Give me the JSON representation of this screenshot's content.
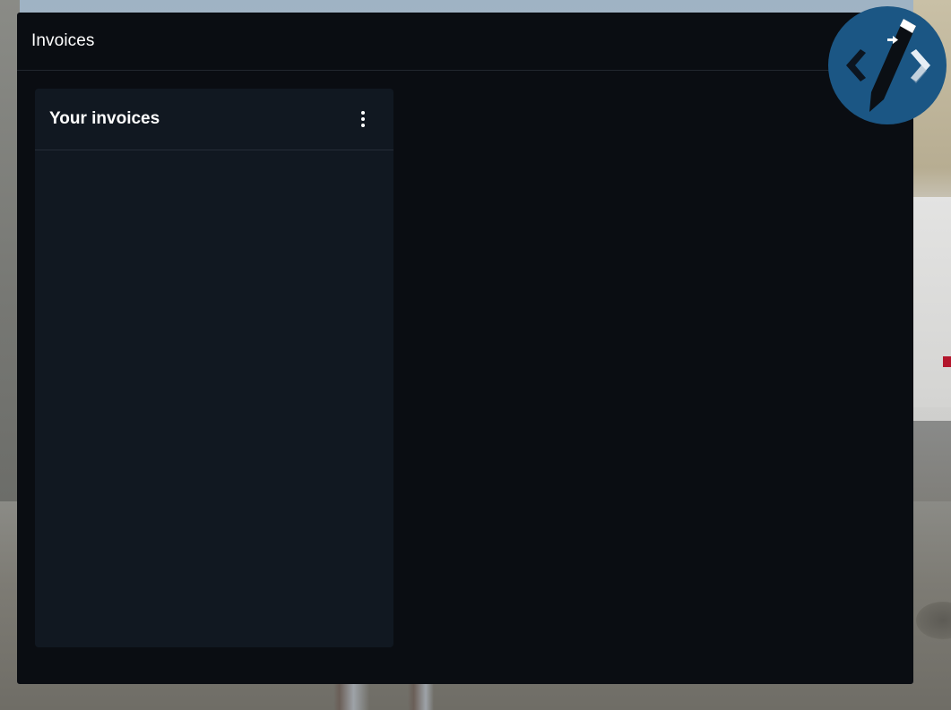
{
  "window": {
    "title": "Invoices"
  },
  "invoices_card": {
    "title": "Your invoices",
    "menu_icon": "more-vertical-icon"
  },
  "overlay": {
    "logo_icon": "code-pencil-logo"
  },
  "colors": {
    "window_background": "#0a0d12",
    "card_background": "#111821",
    "logo_background": "#1b5684"
  }
}
